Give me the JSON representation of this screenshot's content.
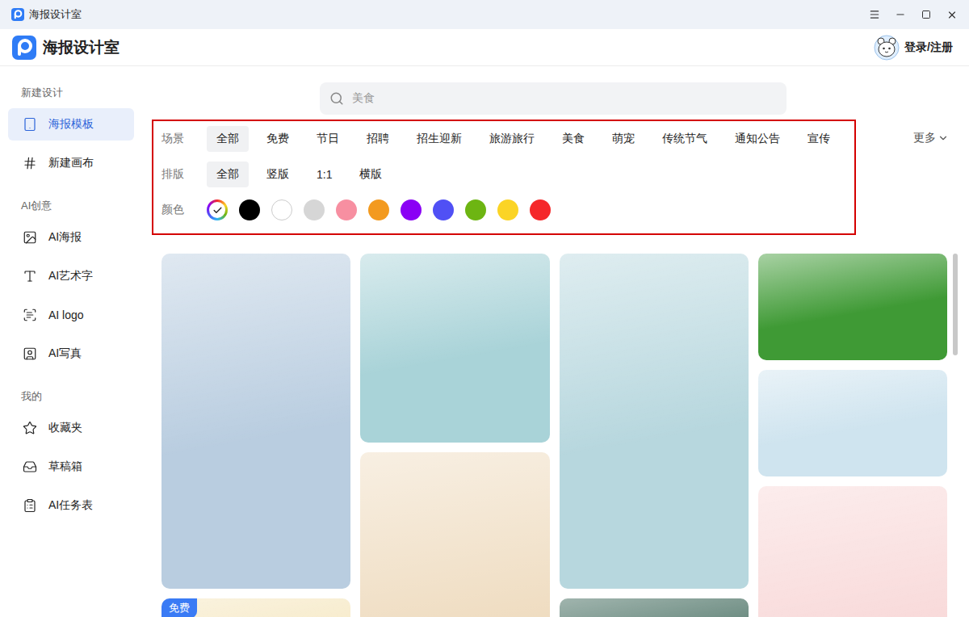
{
  "window": {
    "title": "海报设计室"
  },
  "header": {
    "app_name": "海报设计室",
    "login": "登录/注册"
  },
  "sidebar": {
    "sections": [
      {
        "title": "新建设计",
        "items": [
          {
            "label": "海报模板",
            "selected": true
          },
          {
            "label": "新建画布",
            "selected": false
          }
        ]
      },
      {
        "title": "AI创意",
        "items": [
          {
            "label": "AI海报",
            "selected": false
          },
          {
            "label": "AI艺术字",
            "selected": false
          },
          {
            "label": "AI logo",
            "selected": false
          },
          {
            "label": "AI写真",
            "selected": false
          }
        ]
      },
      {
        "title": "我的",
        "items": [
          {
            "label": "收藏夹",
            "selected": false
          },
          {
            "label": "草稿箱",
            "selected": false
          },
          {
            "label": "AI任务表",
            "selected": false
          }
        ]
      }
    ]
  },
  "search": {
    "placeholder": "美食"
  },
  "filters": {
    "scene": {
      "label": "场景",
      "options": [
        {
          "label": "全部",
          "selected": true
        },
        {
          "label": "免费",
          "selected": false
        },
        {
          "label": "节日",
          "selected": false
        },
        {
          "label": "招聘",
          "selected": false
        },
        {
          "label": "招生迎新",
          "selected": false
        },
        {
          "label": "旅游旅行",
          "selected": false
        },
        {
          "label": "美食",
          "selected": false
        },
        {
          "label": "萌宠",
          "selected": false
        },
        {
          "label": "传统节气",
          "selected": false
        },
        {
          "label": "通知公告",
          "selected": false
        },
        {
          "label": "宣传",
          "selected": false
        }
      ]
    },
    "layout": {
      "label": "排版",
      "options": [
        {
          "label": "全部",
          "selected": true
        },
        {
          "label": "竖版",
          "selected": false
        },
        {
          "label": "1:1",
          "selected": false
        },
        {
          "label": "横版",
          "selected": false
        }
      ]
    },
    "color": {
      "label": "颜色",
      "swatches": [
        {
          "kind": "all",
          "selected": true
        },
        {
          "kind": "solid",
          "color": "#000000",
          "selected": false
        },
        {
          "kind": "solid",
          "color": "#ffffff",
          "selected": false
        },
        {
          "kind": "solid",
          "color": "#d6d6d6",
          "selected": false
        },
        {
          "kind": "solid",
          "color": "#f78fa1",
          "selected": false
        },
        {
          "kind": "solid",
          "color": "#f39a1f",
          "selected": false
        },
        {
          "kind": "solid",
          "color": "#8a00f5",
          "selected": false
        },
        {
          "kind": "solid",
          "color": "#5050f5",
          "selected": false
        },
        {
          "kind": "solid",
          "color": "#6db512",
          "selected": false
        },
        {
          "kind": "solid",
          "color": "#fbd425",
          "selected": false
        },
        {
          "kind": "solid",
          "color": "#f5282a",
          "selected": false
        }
      ]
    },
    "more": "更多"
  },
  "templates": {
    "columns": [
      [
        {
          "kind": "vertical",
          "color": "#b9cde0"
        },
        {
          "kind": "square",
          "color": "#f4e4b8",
          "badge": "免费"
        }
      ],
      [
        {
          "kind": "square",
          "color": "#a9d3d8"
        },
        {
          "kind": "vertical",
          "color": "#efdcc0"
        }
      ],
      [
        {
          "kind": "vertical",
          "color": "#b7d7de"
        },
        {
          "kind": "square",
          "color": "#2d5a4b"
        }
      ],
      [
        {
          "kind": "landscape",
          "color": "#3f9a35"
        },
        {
          "kind": "landscape",
          "color": "#cfe4ef"
        },
        {
          "kind": "vertical",
          "color": "#f8d6d6"
        }
      ]
    ]
  }
}
